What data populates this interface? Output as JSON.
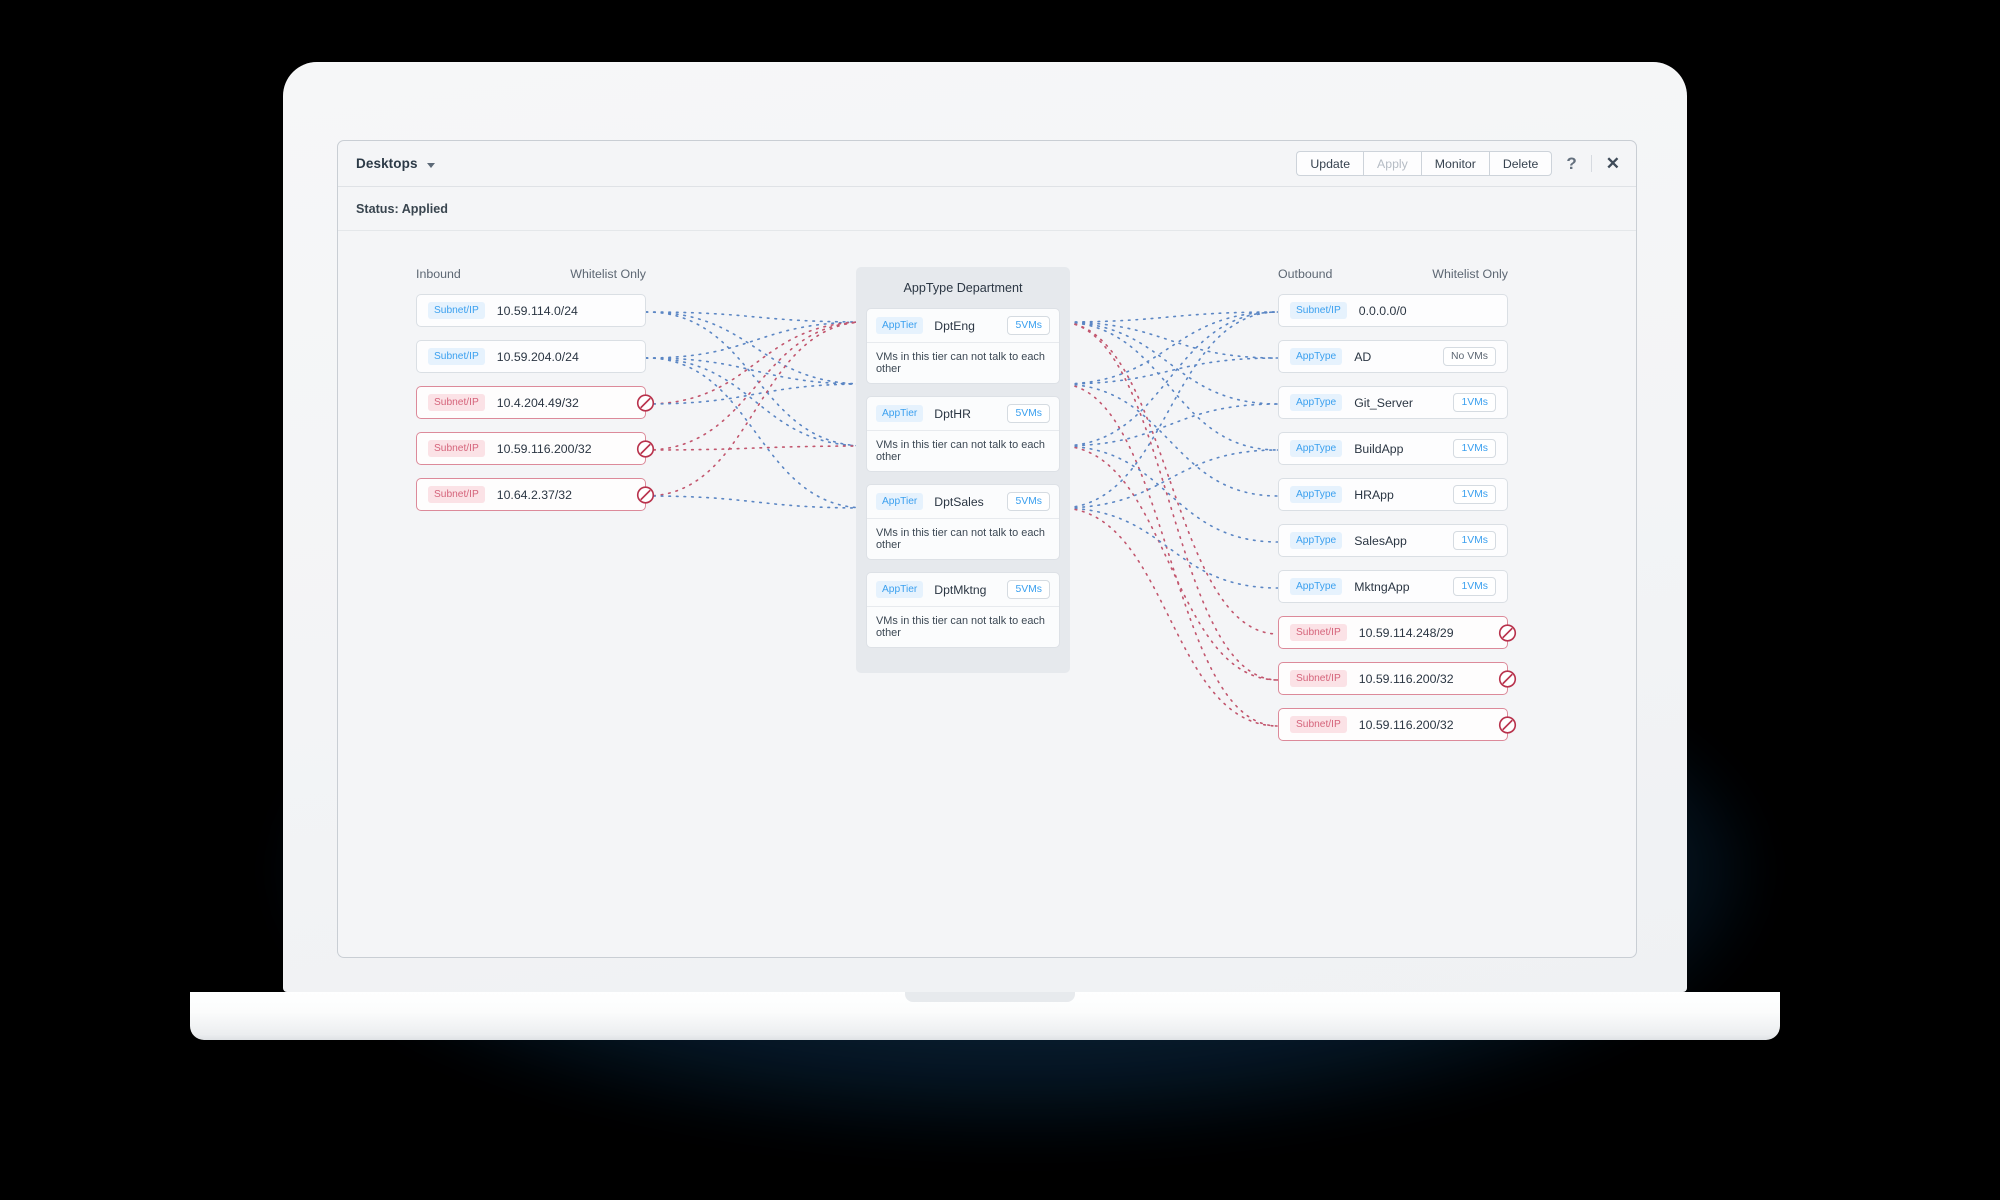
{
  "window": {
    "title": "Desktops",
    "dropdown_icon": "chevron-down-icon",
    "status": "Status: Applied",
    "toolbar": {
      "update": "Update",
      "apply": "Apply",
      "monitor": "Monitor",
      "delete": "Delete",
      "help": "?",
      "close": "✕"
    }
  },
  "inbound": {
    "header": "Inbound",
    "policy_header": "Whitelist Only",
    "items": [
      {
        "tag": "Subnet/IP",
        "label": "10.59.114.0/24",
        "blocked": false,
        "badge": null
      },
      {
        "tag": "Subnet/IP",
        "label": "10.59.204.0/24",
        "blocked": false,
        "badge": null
      },
      {
        "tag": "Subnet/IP",
        "label": "10.4.204.49/32",
        "blocked": true,
        "badge": null
      },
      {
        "tag": "Subnet/IP",
        "label": "10.59.116.200/32",
        "blocked": true,
        "badge": null
      },
      {
        "tag": "Subnet/IP",
        "label": "10.64.2.37/32",
        "blocked": true,
        "badge": null
      }
    ]
  },
  "center": {
    "title": "AppType Department",
    "tiers": [
      {
        "tag": "AppTier",
        "name": "DptEng",
        "vms": "5VMs",
        "note": "VMs in this tier can not talk to each other"
      },
      {
        "tag": "AppTier",
        "name": "DptHR",
        "vms": "5VMs",
        "note": "VMs in this tier can not talk to each other"
      },
      {
        "tag": "AppTier",
        "name": "DptSales",
        "vms": "5VMs",
        "note": "VMs in this tier can not talk to each other"
      },
      {
        "tag": "AppTier",
        "name": "DptMktng",
        "vms": "5VMs",
        "note": "VMs in this tier can not talk to each other"
      }
    ]
  },
  "outbound": {
    "header": "Outbound",
    "policy_header": "Whitelist Only",
    "items": [
      {
        "tag": "Subnet/IP",
        "label": "0.0.0.0/0",
        "blocked": false,
        "badge": null
      },
      {
        "tag": "AppType",
        "label": "AD",
        "blocked": false,
        "badge": "No VMs"
      },
      {
        "tag": "AppType",
        "label": "Git_Server",
        "blocked": false,
        "badge": "1VMs"
      },
      {
        "tag": "AppType",
        "label": "BuildApp",
        "blocked": false,
        "badge": "1VMs"
      },
      {
        "tag": "AppType",
        "label": "HRApp",
        "blocked": false,
        "badge": "1VMs"
      },
      {
        "tag": "AppType",
        "label": "SalesApp",
        "blocked": false,
        "badge": "1VMs"
      },
      {
        "tag": "AppType",
        "label": "MktngApp",
        "blocked": false,
        "badge": "1VMs"
      },
      {
        "tag": "Subnet/IP",
        "label": "10.59.114.248/29",
        "blocked": true,
        "badge": null
      },
      {
        "tag": "Subnet/IP",
        "label": "10.59.116.200/32",
        "blocked": true,
        "badge": null
      },
      {
        "tag": "Subnet/IP",
        "label": "10.59.116.200/32",
        "blocked": true,
        "badge": null
      }
    ]
  },
  "colors": {
    "allow": "#5b86c4",
    "block": "#c2566e",
    "tag_blue_bg": "#e6f2fd",
    "tag_blue_text": "#3ba0ef",
    "tag_red_bg": "#fbe2e6",
    "tag_red_text": "#d5647b",
    "panel_bg": "#e6e9ed"
  }
}
